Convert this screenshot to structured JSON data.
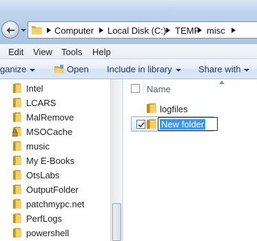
{
  "address": {
    "crumbs": [
      "Computer",
      "Local Disk (C:)",
      "TEMP",
      "misc"
    ]
  },
  "menu": {
    "items": [
      "Edit",
      "View",
      "Tools",
      "Help"
    ]
  },
  "commands": {
    "organize": "ganize",
    "open": "Open",
    "include": "Include in library",
    "share": "Share with"
  },
  "nav": {
    "items": [
      "Intel",
      "LCARS",
      "MalRemove",
      "MSOCache",
      "music",
      "My E-Books",
      "OtsLabs",
      "OutputFolder",
      "patchmypc.net",
      "PerfLogs",
      "powershell"
    ]
  },
  "content": {
    "column_name": "Name",
    "items": [
      "logfiles"
    ],
    "rename_value": "New folder"
  },
  "colors": {
    "folder": "#e8c152",
    "selection": "#3399ff",
    "accent": "#1e395b"
  },
  "icons": {
    "folder": "folder-icon",
    "locked_folder": "locked-folder-icon",
    "open": "open-icon",
    "back": "back-arrow-icon"
  }
}
